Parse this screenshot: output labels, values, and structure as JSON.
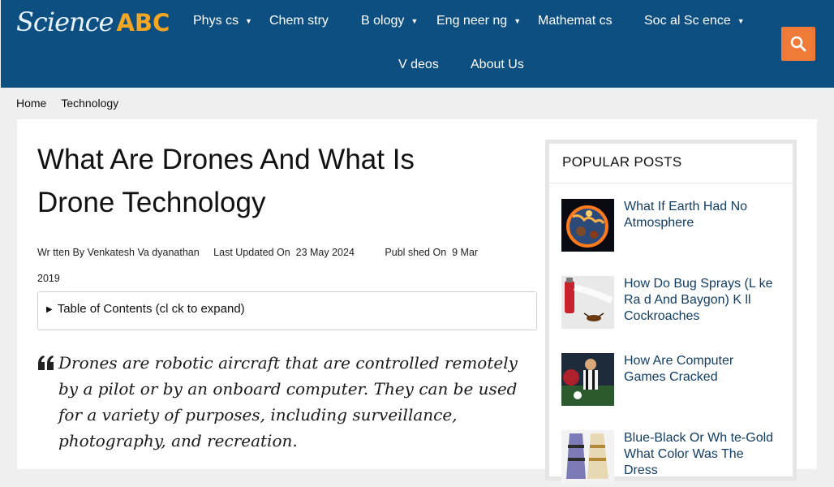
{
  "logo": {
    "part1": "Science",
    "part2": "ABC"
  },
  "nav": {
    "items": [
      {
        "label": "Phys cs",
        "caret": "▼"
      },
      {
        "label": "Chem stry",
        "caret": ""
      },
      {
        "label": "B ology",
        "caret": "▼"
      },
      {
        "label": "Eng neer ng",
        "caret": "▼"
      },
      {
        "label": "Mathemat cs",
        "caret": ""
      },
      {
        "label": "Soc al Sc ence",
        "caret": "▼"
      },
      {
        "label": "V deos",
        "caret": ""
      },
      {
        "label": "About Us",
        "caret": ""
      }
    ]
  },
  "breadcrumb": {
    "items": [
      "Home",
      "Technology"
    ]
  },
  "article": {
    "title": "What Are Drones And What Is Drone Technology",
    "meta": {
      "written_by_label": "Wr tten By",
      "author": "Venkatesh Va dyanathan",
      "updated_label": "Last Updated On",
      "updated_date": "23 May 2024",
      "published_label": "Publ shed On",
      "published_date": "9 Mar 2019"
    },
    "toc_label": "Table of Contents (cl ck to expand)",
    "quote": "Drones are robotic aircraft that are controlled remotely by a pilot or by an onboard computer. They can be used for a variety of purposes, including surveillance, photography, and recreation."
  },
  "sidebar": {
    "title": "POPULAR POSTS",
    "posts": [
      {
        "title": "What If Earth Had No Atmosphere",
        "thumb": "earth-burning-image"
      },
      {
        "title": "How Do Bug Sprays (L ke Ra d And Baygon) K ll Cockroaches",
        "thumb": "bug-spray-image"
      },
      {
        "title": "How Are Computer Games  Cracked",
        "thumb": "football-game-image"
      },
      {
        "title": "Blue-Black Or Wh te-Gold   What Color Was The Dress",
        "thumb": "dress-image"
      }
    ]
  },
  "colors": {
    "header_bg": "#0d4f80",
    "accent": "#f07b38",
    "logo_abc": "#f5a623",
    "post_link": "#123d63"
  }
}
